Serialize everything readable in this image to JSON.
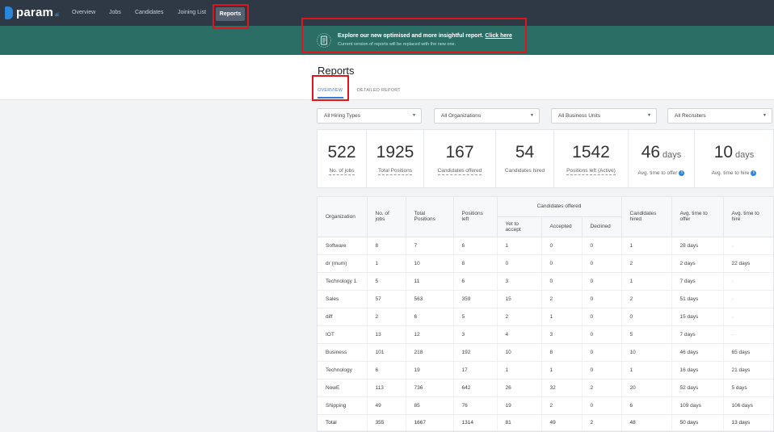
{
  "nav": {
    "logo": "param",
    "logo_suffix": "ai",
    "items": [
      "Overview",
      "Jobs",
      "Candidates",
      "Joining List"
    ],
    "active": "Reports"
  },
  "banner": {
    "title": "Explore our new optimised and more insightful report.",
    "link": "Click here",
    "subtitle": "Current version of reports will be replaced with the new one."
  },
  "page": {
    "title": "Reports",
    "tabs": [
      "OVERVIEW",
      "DETAILED REPORT"
    ]
  },
  "filters": [
    "All Hiring Types",
    "All Organizations",
    "All Business Units",
    "All Recruiters"
  ],
  "stats": [
    {
      "value": "522",
      "label": "No. of jobs",
      "unit": "",
      "dashed": true
    },
    {
      "value": "1925",
      "label": "Total Positions",
      "unit": "",
      "dashed": true
    },
    {
      "value": "167",
      "label": "Candidates offered",
      "unit": "",
      "dashed": true
    },
    {
      "value": "54",
      "label": "Candidates hired",
      "unit": "",
      "dashed": false
    },
    {
      "value": "1542",
      "label": "Positions left (Active)",
      "unit": "",
      "dashed": true
    },
    {
      "value": "46",
      "label": "Avg. time to offer",
      "unit": "days",
      "dashed": false,
      "info": true
    },
    {
      "value": "10",
      "label": "Avg. time to hire",
      "unit": "days",
      "dashed": false,
      "info": true
    }
  ],
  "table": {
    "headers": {
      "organization": "Organization",
      "jobs": "No. of jobs",
      "positions": "Total Positions",
      "left": "Positions left",
      "offered_group": "Candidates offered",
      "yet": "Yet to accept",
      "accepted": "Accepted",
      "declined": "Declined",
      "hired": "Candidates hired",
      "offer_time": "Avg. time to offer",
      "hire_time": "Avg. time to hire"
    },
    "rows": [
      [
        "Software",
        "8",
        "7",
        "6",
        "1",
        "0",
        "0",
        "1",
        "28 days",
        "-"
      ],
      [
        "dr (mum)",
        "1",
        "10",
        "8",
        "0",
        "0",
        "0",
        "2",
        "2 days",
        "22 days"
      ],
      [
        "Technology 1",
        "5",
        "11",
        "6",
        "3",
        "0",
        "0",
        "1",
        "7 days",
        "-"
      ],
      [
        "Sales",
        "57",
        "563",
        "359",
        "15",
        "2",
        "0",
        "2",
        "51 days",
        "-"
      ],
      [
        "diff",
        "2",
        "6",
        "5",
        "2",
        "1",
        "0",
        "0",
        "15 days",
        "-"
      ],
      [
        "IOT",
        "13",
        "12",
        "3",
        "4",
        "3",
        "0",
        "5",
        "7 days",
        "-"
      ],
      [
        "Business",
        "101",
        "218",
        "192",
        "10",
        "8",
        "0",
        "10",
        "46 days",
        "65 days"
      ],
      [
        "Technology",
        "6",
        "19",
        "17",
        "1",
        "1",
        "0",
        "1",
        "16 days",
        "21 days"
      ],
      [
        "NowE",
        "113",
        "736",
        "642",
        "26",
        "32",
        "2",
        "20",
        "52 days",
        "5 days"
      ],
      [
        "Shipping",
        "49",
        "85",
        "76",
        "19",
        "2",
        "0",
        "6",
        "109 days",
        "106 days"
      ],
      [
        "Total",
        "355",
        "1667",
        "1314",
        "81",
        "49",
        "2",
        "48",
        "50 days",
        "13 days"
      ]
    ]
  }
}
